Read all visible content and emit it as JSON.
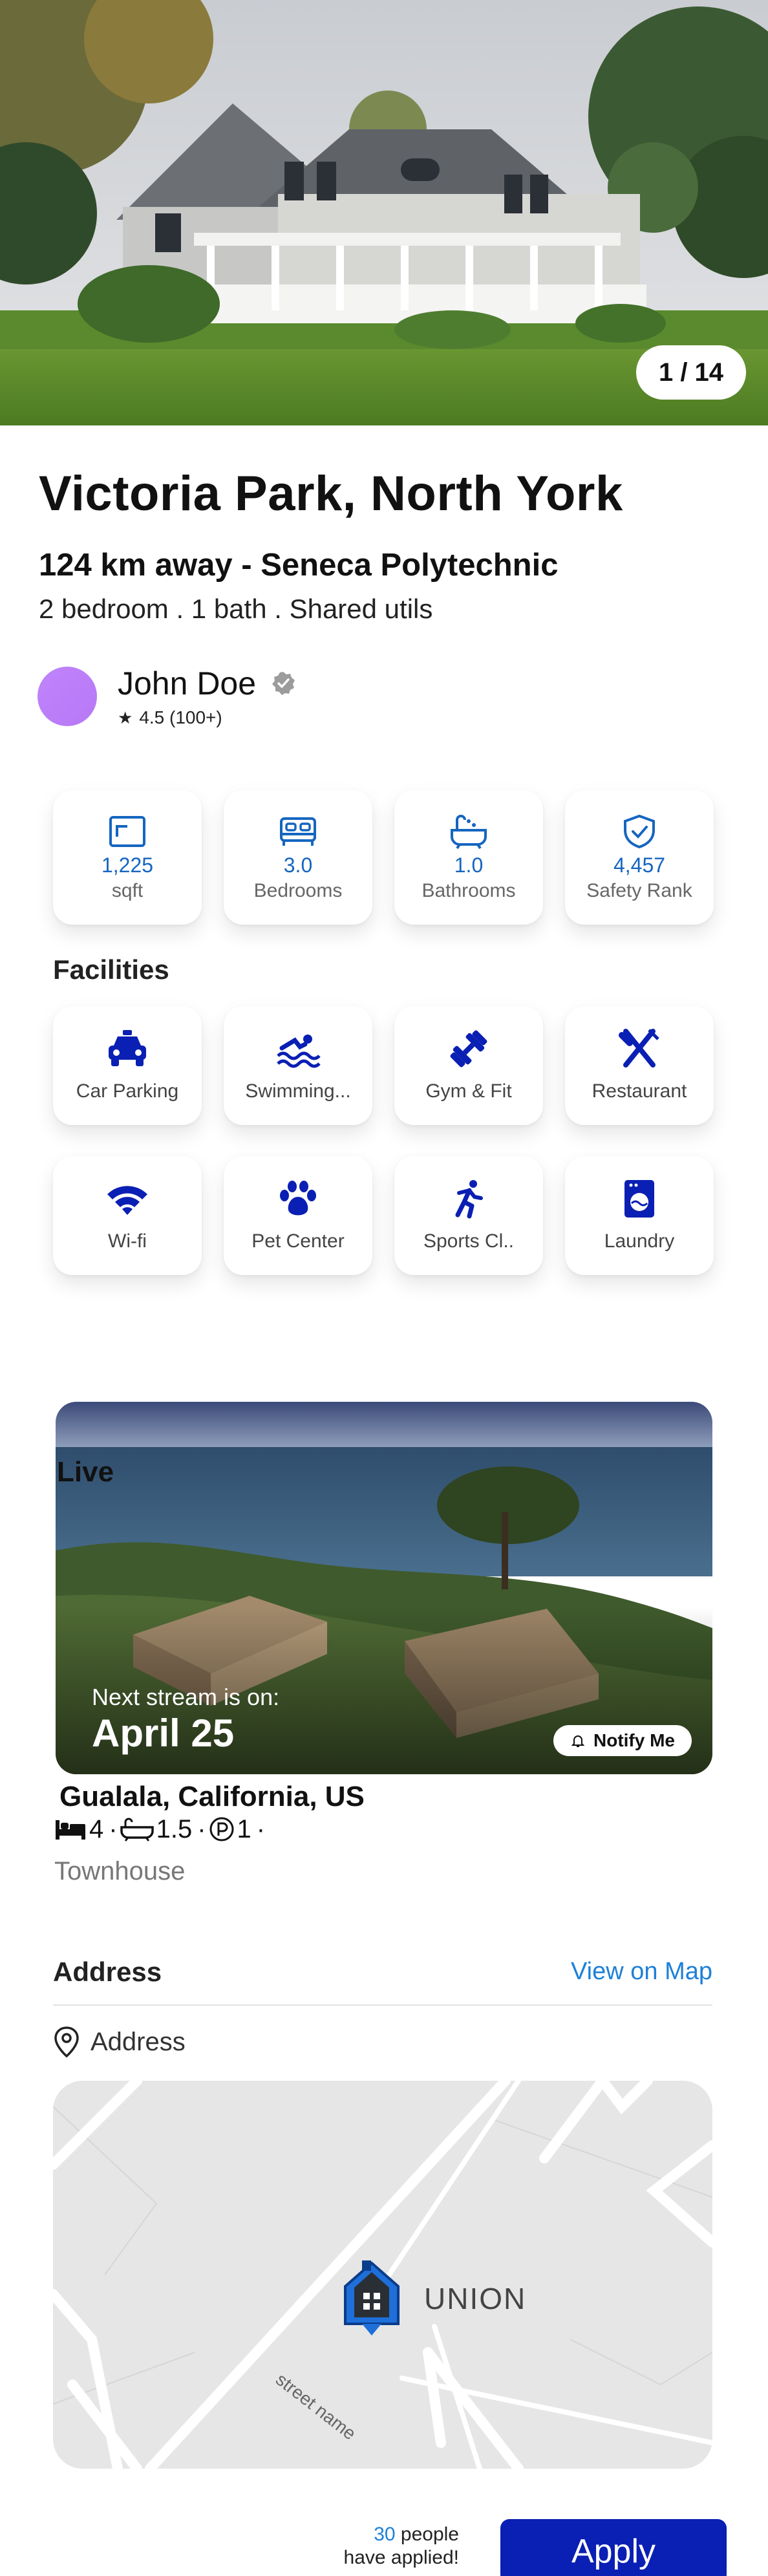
{
  "hero": {
    "photo_counter": "1 / 14"
  },
  "listing": {
    "title": "Victoria Park, North York",
    "distance": "124 km away - Seneca Polytechnic",
    "specs": "2 bedroom . 1 bath . Shared utils"
  },
  "host": {
    "name": "John Doe",
    "rating": "4.5 (100+)",
    "star": "★"
  },
  "stats": [
    {
      "icon": "area-icon",
      "value": "1,225",
      "label": "sqft"
    },
    {
      "icon": "bed-icon",
      "value": "3.0",
      "label": "Bedrooms"
    },
    {
      "icon": "bathtub-icon",
      "value": "1.0",
      "label": "Bathrooms"
    },
    {
      "icon": "shield-check-icon",
      "value": "4,457",
      "label": "Safety Rank"
    }
  ],
  "facilities": {
    "title": "Facilities",
    "items": [
      {
        "icon": "car-icon",
        "label": "Car Parking"
      },
      {
        "icon": "swimming-icon",
        "label": "Swimming..."
      },
      {
        "icon": "dumbbell-icon",
        "label": "Gym & Fit"
      },
      {
        "icon": "restaurant-icon",
        "label": "Restaurant"
      },
      {
        "icon": "wifi-icon",
        "label": "Wi-fi"
      },
      {
        "icon": "paw-icon",
        "label": "Pet Center"
      },
      {
        "icon": "running-icon",
        "label": "Sports Cl.."
      },
      {
        "icon": "washing-machine-icon",
        "label": "Laundry"
      }
    ]
  },
  "live": {
    "badge": "Live",
    "next_stream_label": "Next stream is on:",
    "date": "April 25",
    "notify_label": "Notify Me"
  },
  "featured": {
    "name": "Gualala, California, US",
    "beds": "4",
    "baths": "1.5",
    "parking": "1",
    "separator": "·",
    "type": "Townhouse"
  },
  "address": {
    "title": "Address",
    "view_on_map": "View on Map",
    "label": "Address",
    "map_place": "UNION",
    "street_label": "street name"
  },
  "footer": {
    "applied_count": "30",
    "applied_suffix": "people",
    "applied_line2": "have applied!",
    "apply_label": "Apply"
  },
  "colors": {
    "accent_blue": "#1565c0",
    "deep_blue": "#0a1fb3",
    "link_blue": "#1e80d8",
    "avatar_purple": "#c084fc"
  }
}
